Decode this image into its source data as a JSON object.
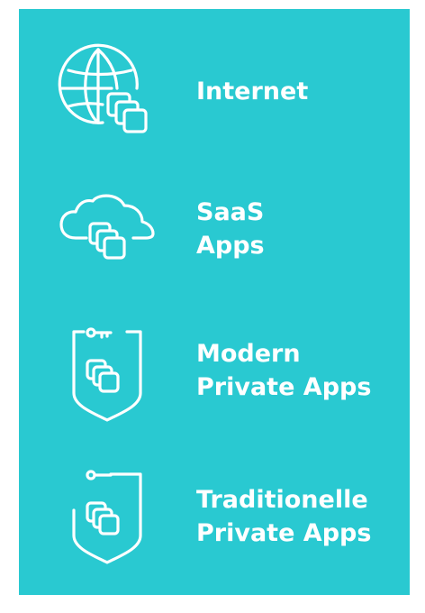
{
  "colors": {
    "panel_background": "#29c9d1",
    "foreground": "#ffffff"
  },
  "items": [
    {
      "icon": "globe-with-apps-icon",
      "label_lines": [
        "Internet"
      ]
    },
    {
      "icon": "cloud-with-apps-icon",
      "label_lines": [
        "SaaS",
        "Apps"
      ]
    },
    {
      "icon": "shield-key-apps-icon",
      "label_lines": [
        "Modern",
        "Private Apps"
      ]
    },
    {
      "icon": "shield-key-apps-legacy-icon",
      "label_lines": [
        "Traditionelle",
        "Private Apps"
      ]
    }
  ]
}
